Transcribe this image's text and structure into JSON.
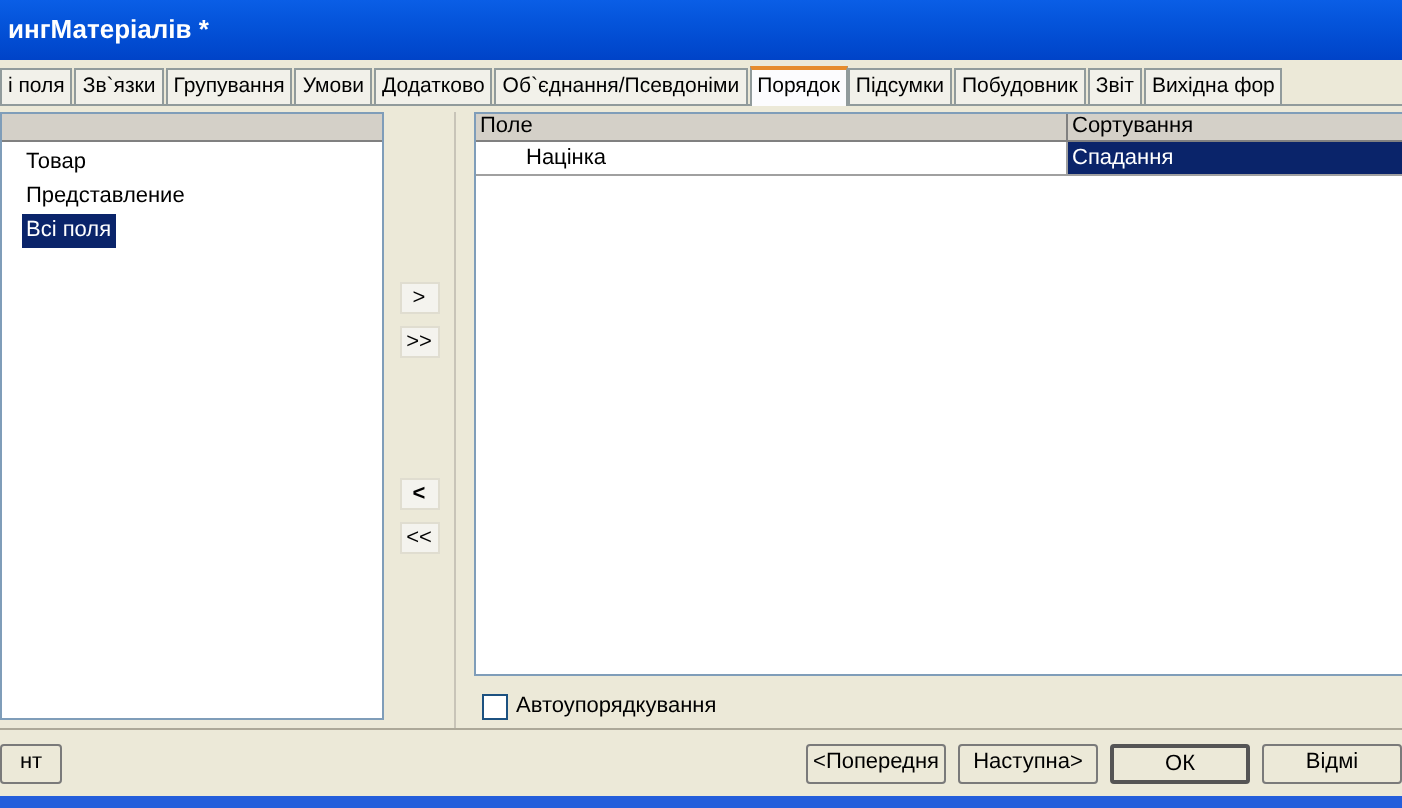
{
  "window": {
    "title": "ингМатеріалів *"
  },
  "tabs": [
    {
      "label": "і поля",
      "selected": false
    },
    {
      "label": "Зв`язки",
      "selected": false
    },
    {
      "label": "Групування",
      "selected": false
    },
    {
      "label": "Умови",
      "selected": false
    },
    {
      "label": "Додатково",
      "selected": false
    },
    {
      "label": "Об`єднання/Псевдоніми",
      "selected": false
    },
    {
      "label": "Порядок",
      "selected": true
    },
    {
      "label": "Підсумки",
      "selected": false
    },
    {
      "label": "Побудовник",
      "selected": false
    },
    {
      "label": "Звіт",
      "selected": false
    },
    {
      "label": "Вихідна фор",
      "selected": false
    }
  ],
  "field_list": {
    "items": [
      {
        "label": "Товар",
        "selected": false
      },
      {
        "label": "Представление",
        "selected": false
      },
      {
        "label": "Всі поля",
        "selected": true
      }
    ]
  },
  "move_buttons": [
    ">",
    ">>",
    "<",
    "<<"
  ],
  "order_table": {
    "columns": [
      "Поле",
      "Сортування"
    ],
    "rows": [
      {
        "field": "Націнка",
        "sort": "Спадання",
        "selected": true
      }
    ]
  },
  "auto_order": {
    "label": "Автоупорядкування",
    "checked": false
  },
  "footer_buttons": [
    {
      "label": "нт",
      "kind": "side"
    },
    {
      "label": "<Попередня",
      "kind": "nav"
    },
    {
      "label": "Наступна>",
      "kind": "nav"
    },
    {
      "label": "ОК",
      "kind": "default"
    },
    {
      "label": "Відмі",
      "kind": "nav"
    }
  ]
}
